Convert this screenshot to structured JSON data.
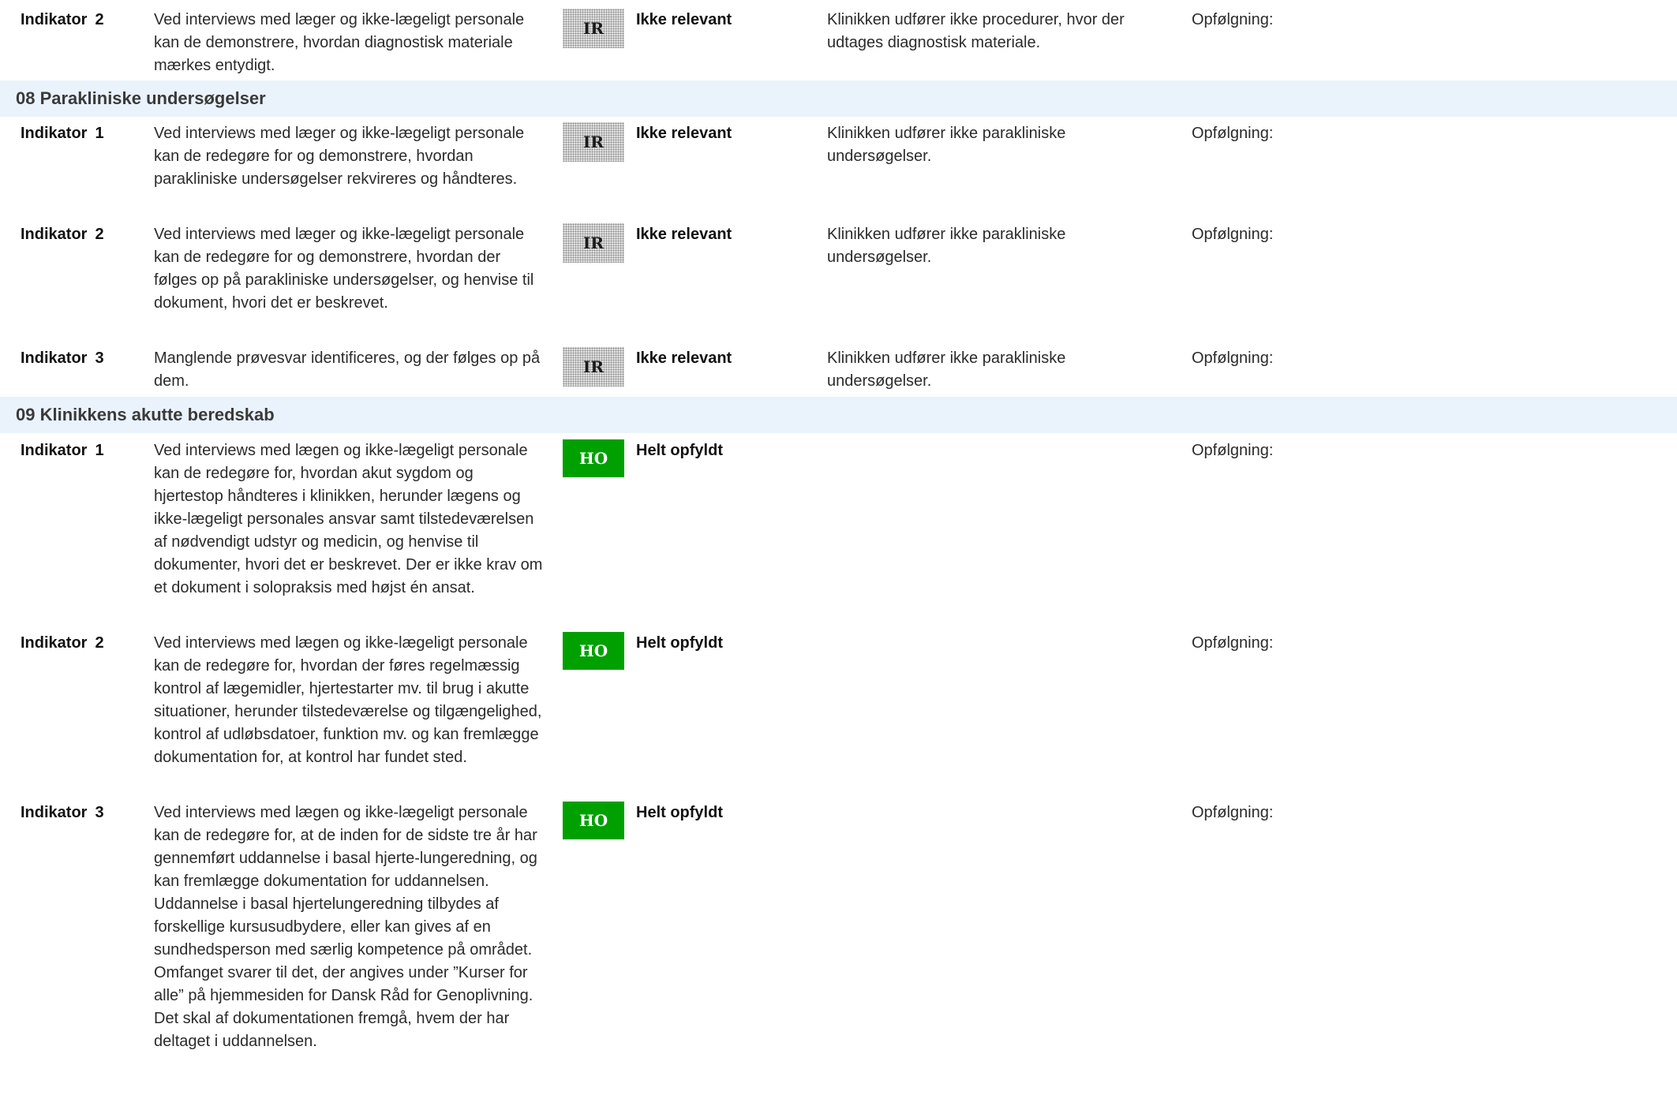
{
  "follow_label": "Opfølgning:",
  "rows": [
    {
      "indicator_label": "Indikator",
      "indicator_num": "2",
      "description": "Ved interviews med læger og ikke-lægeligt personale kan de demonstrere, hvordan diagnostisk materiale mærkes entydigt.",
      "badge": "IR",
      "status": "Ikke relevant",
      "comment": "Klinikken udfører ikke procedurer, hvor der udtages diagnostisk materiale."
    }
  ],
  "sections": [
    {
      "title": "08 Parakliniske undersøgelser",
      "rows": [
        {
          "indicator_label": "Indikator",
          "indicator_num": "1",
          "description": "Ved interviews med læger og ikke-lægeligt personale kan de redegøre for og demonstrere, hvordan parakliniske undersøgelser rekvireres og håndteres.",
          "badge": "IR",
          "status": "Ikke relevant",
          "comment": "Klinikken udfører ikke parakliniske undersøgelser."
        },
        {
          "indicator_label": "Indikator",
          "indicator_num": "2",
          "description": "Ved interviews med læger og ikke-lægeligt personale kan de redegøre for og demonstrere, hvordan der følges op på parakliniske undersøgelser, og henvise til dokument, hvori det er beskrevet.",
          "badge": "IR",
          "status": "Ikke relevant",
          "comment": "Klinikken udfører ikke parakliniske undersøgelser."
        },
        {
          "indicator_label": "Indikator",
          "indicator_num": "3",
          "description": "Manglende prøvesvar identificeres, og der følges op på dem.",
          "badge": "IR",
          "status": "Ikke relevant",
          "comment": "Klinikken udfører ikke parakliniske undersøgelser."
        }
      ]
    },
    {
      "title": "09 Klinikkens akutte beredskab",
      "rows": [
        {
          "indicator_label": "Indikator",
          "indicator_num": "1",
          "description": "Ved interviews med lægen og ikke-lægeligt personale kan de redegøre for, hvordan akut sygdom og hjertestop håndteres i klinikken, herunder lægens og ikke-lægeligt personales ansvar samt tilstedeværelsen af nødvendigt udstyr og medicin, og henvise til dokumenter, hvori det er beskrevet.   Der er ikke krav om et dokument i solopraksis med højst én ansat.",
          "badge": "HO",
          "status": "Helt opfyldt",
          "comment": ""
        },
        {
          "indicator_label": "Indikator",
          "indicator_num": "2",
          "description": "Ved interviews med lægen og ikke-lægeligt personale kan de redegøre for, hvordan der føres regelmæssig kontrol af lægemidler, hjertestarter mv. til brug i akutte situationer, herunder tilstedeværelse og tilgængelighed, kontrol af udløbsdatoer, funktion mv. og kan fremlægge dokumentation for, at kontrol har fundet sted.",
          "badge": "HO",
          "status": "Helt opfyldt",
          "comment": ""
        },
        {
          "indicator_label": "Indikator",
          "indicator_num": "3",
          "description": "Ved interviews med lægen og ikke-lægeligt personale kan de redegøre for, at de inden for de sidste tre år har gennemført uddannelse i basal hjerte-lungeredning, og kan fremlægge dokumentation for uddannelsen.   Uddannelse i basal hjertelungeredning tilbydes af forskellige kursusudbydere, eller kan gives af en sundhedsperson med særlig kompetence på området. Omfanget svarer til det, der angives under ”Kurser for alle” på hjemmesiden for Dansk Råd for Genoplivning.   Det skal af dokumentationen fremgå, hvem der har deltaget i uddannelsen.",
          "badge": "HO",
          "status": "Helt opfyldt",
          "comment": ""
        }
      ]
    }
  ]
}
